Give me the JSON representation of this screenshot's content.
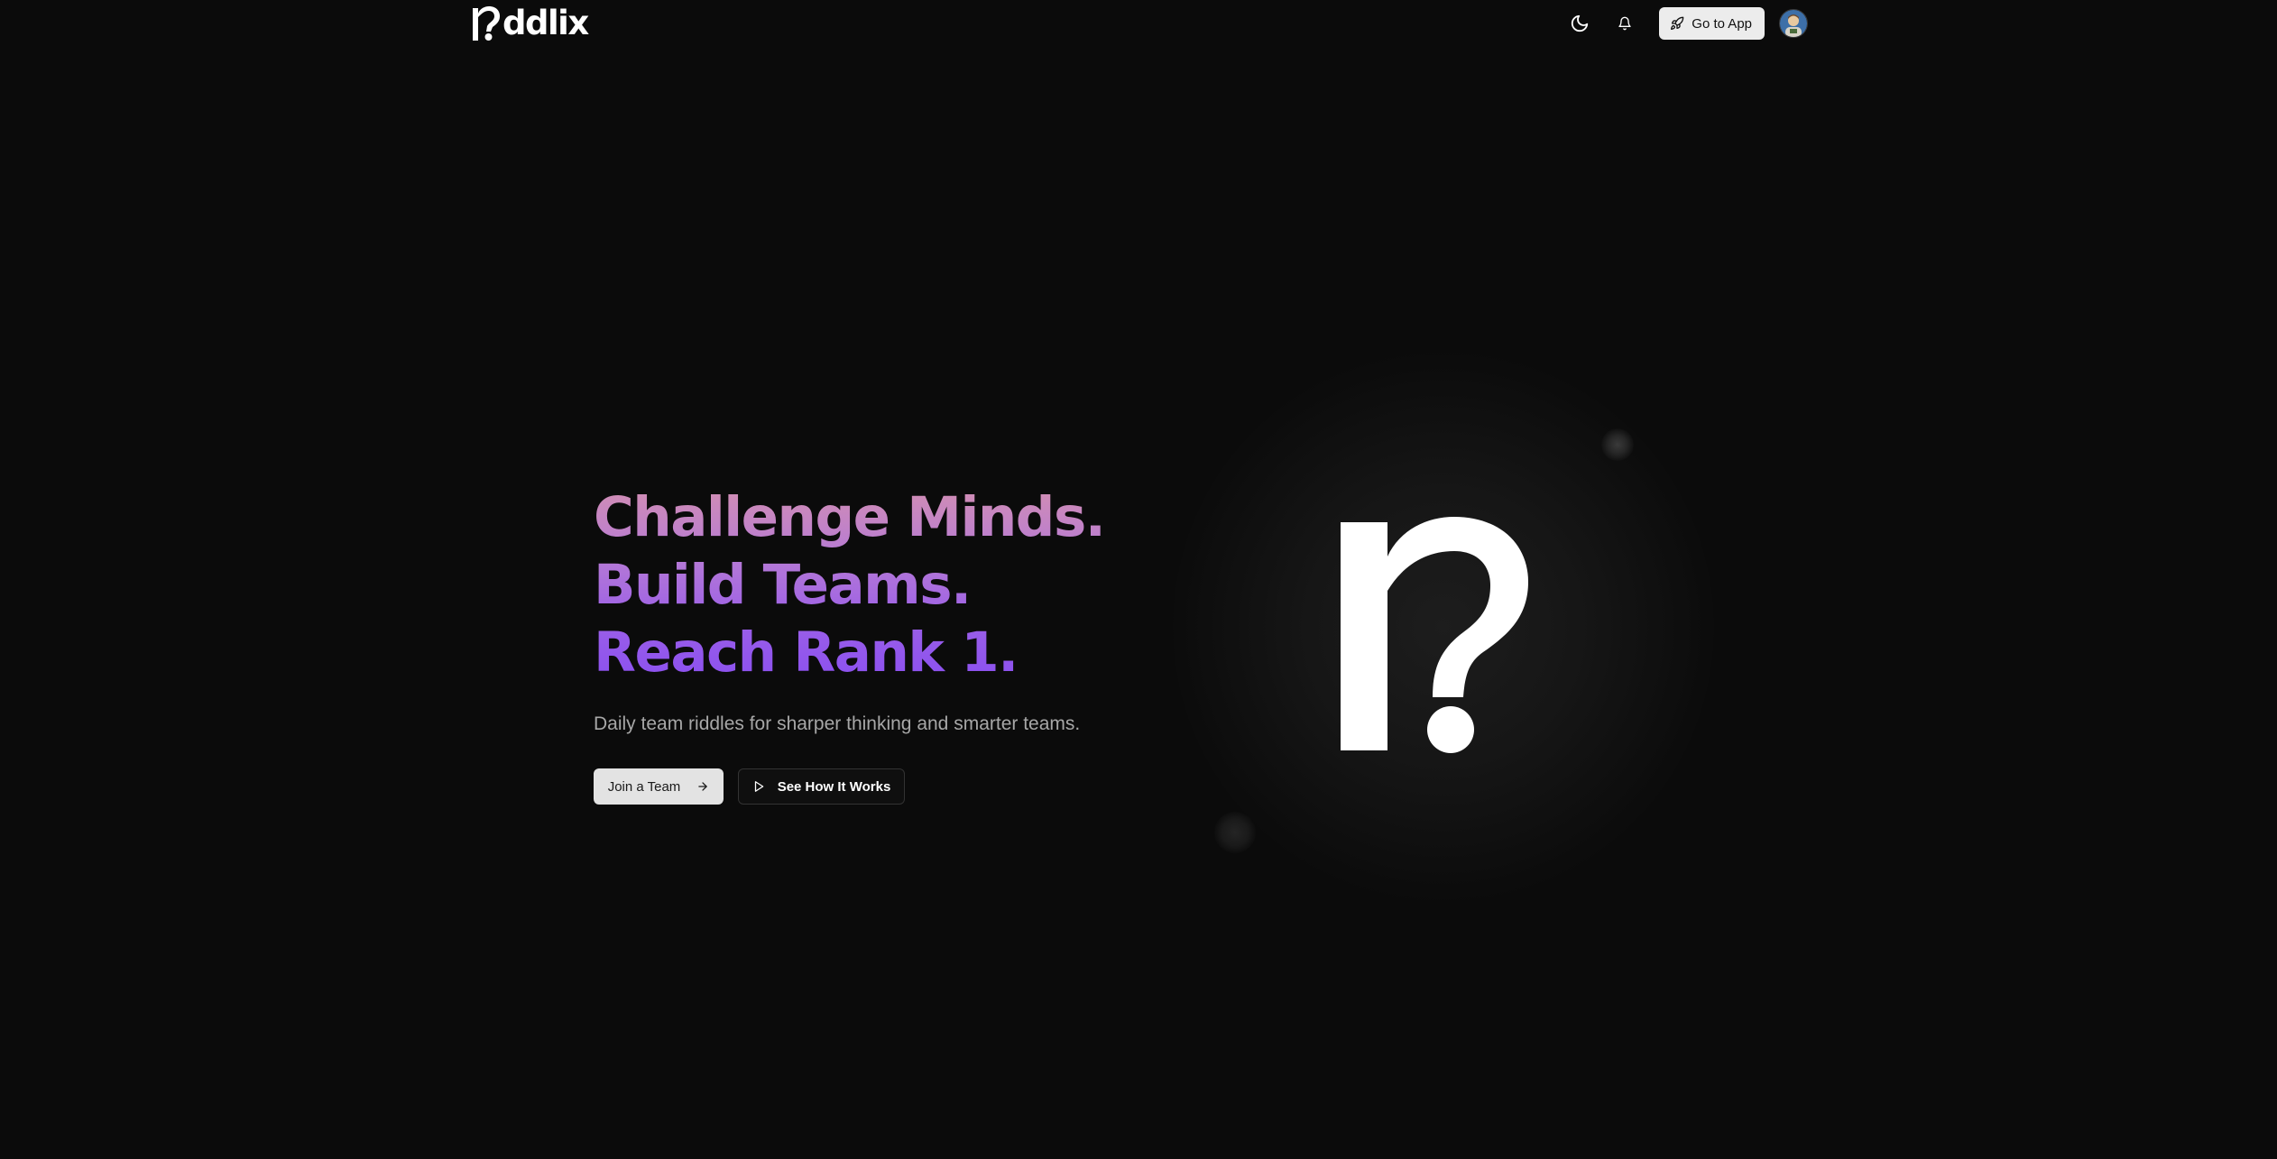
{
  "header": {
    "logo_text": "ddlix",
    "logo_icon": "riddlix-question-mark-logo",
    "theme_toggle_icon": "moon-icon",
    "notifications_icon": "bell-icon",
    "go_to_app_label": "Go to App",
    "go_to_app_icon": "rocket-icon",
    "avatar_icon": "user-avatar"
  },
  "hero": {
    "headline_lines": [
      "Challenge Minds.",
      "Build Teams.",
      "Reach Rank 1."
    ],
    "subtitle": "Daily team riddles for sharper thinking and smarter teams.",
    "primary_cta": {
      "label": "Join a Team",
      "icon": "arrow-right-icon"
    },
    "secondary_cta": {
      "label": "See How It Works",
      "icon": "play-icon"
    },
    "graphic_icon": "riddlix-question-mark-logo"
  },
  "colors": {
    "background": "#0b0b0b",
    "headline_gradient_start": "#d38fb2",
    "headline_gradient_end": "#8a4ff0",
    "subtitle": "#a7a7a7",
    "primary_button_bg": "#e3e3e3",
    "secondary_button_border": "#333333"
  }
}
